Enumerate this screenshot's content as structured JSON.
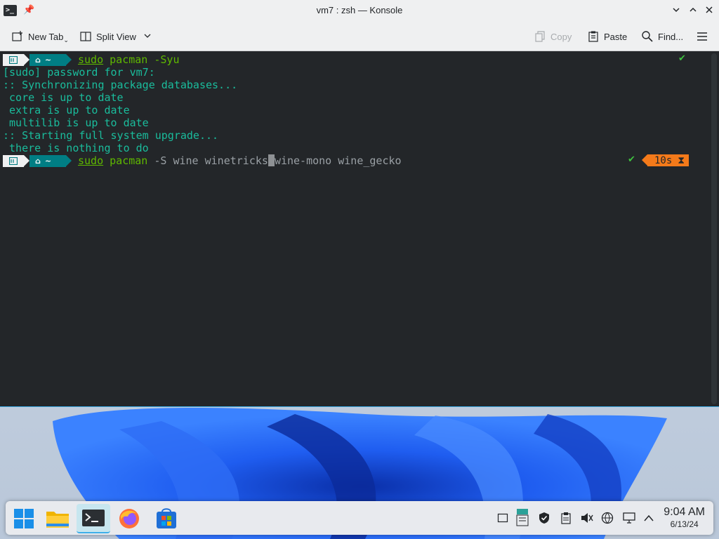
{
  "window": {
    "title": "vm7 : zsh — Konsole",
    "app_icon_glyph": ">_",
    "controls": [
      "minimize",
      "maximize",
      "close"
    ]
  },
  "toolbar": {
    "new_tab": "New Tab",
    "split_view": "Split View",
    "copy": "Copy",
    "paste": "Paste",
    "find": "Find..."
  },
  "terminal": {
    "prompt_os_glyph": "⌂",
    "prompt_dir": "~",
    "cmd1": {
      "w1": "sudo",
      "w2": "pacman",
      "rest": " -Syu"
    },
    "output": [
      "[sudo] password for vm7:",
      ":: Synchronizing package databases...",
      " core is up to date",
      " extra is up to date",
      " multilib is up to date",
      ":: Starting full system upgrade...",
      " there is nothing to do"
    ],
    "cmd2": {
      "w1": "sudo",
      "w2": "pacman",
      "mid": " -S wine winetricks",
      "after_cursor": "wine-mono wine_gecko"
    },
    "status_check": "✔",
    "duration": "10s",
    "duration_icon": "⧗"
  },
  "taskbar": {
    "time": "9:04 AM",
    "date": "6/13/24"
  },
  "colors": {
    "terminal_bg": "#232629",
    "output_teal": "#1abc9c",
    "command_green": "#5fb800",
    "prompt_teal": "#007e84",
    "duration_orange": "#f47a1a",
    "accent_blue": "#3daee9"
  }
}
